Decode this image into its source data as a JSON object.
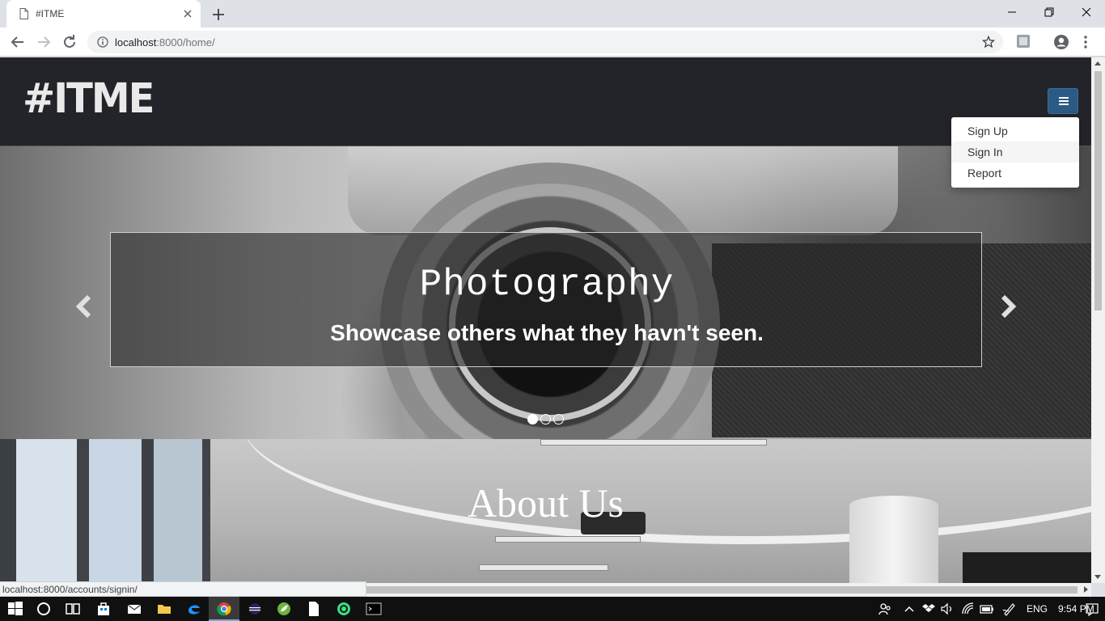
{
  "browser": {
    "tab_title": "#ITME",
    "url_host": "localhost",
    "url_path": ":8000/home/"
  },
  "site": {
    "brand": "#ITME",
    "menu": {
      "items": [
        {
          "label": "Sign Up"
        },
        {
          "label": "Sign In"
        },
        {
          "label": "Report"
        }
      ]
    },
    "carousel": {
      "title": "Photography",
      "subtitle": "Showcase others what they havn't seen.",
      "slides": 3,
      "active_slide": 1
    },
    "about": {
      "title": "About Us"
    }
  },
  "status_url": "localhost:8000/accounts/signin/",
  "taskbar": {
    "language": "ENG",
    "time": "9:54 PM"
  },
  "colors": {
    "navbar_bg": "#222429",
    "toggle_bg": "#2b5a85"
  }
}
